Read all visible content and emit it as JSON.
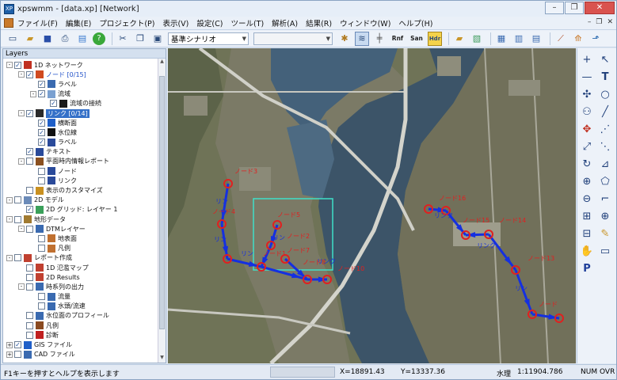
{
  "window": {
    "title": "xpswmm - [data.xp] [Network]",
    "app_icon": "XP",
    "controls": [
      "–",
      "❐",
      "✕"
    ]
  },
  "menubar": {
    "items": [
      "ファイル(F)",
      "編集(E)",
      "プロジェクト(P)",
      "表示(V)",
      "設定(C)",
      "ツール(T)",
      "解析(A)",
      "結果(R)",
      "ウィンドウ(W)",
      "ヘルプ(H)"
    ],
    "mdi_controls": [
      "–",
      "❐",
      "✕"
    ]
  },
  "toolbar": {
    "scenario": "基準シナリオ",
    "second_combo": "",
    "btn_rnf": "Rnf",
    "btn_san": "San",
    "btn_hdr": "Hdr"
  },
  "layers": {
    "title": "Layers",
    "tree": [
      {
        "label": "1D ネットワーク",
        "level": 0,
        "checked": true,
        "exp": "-"
      },
      {
        "label": "ノード",
        "count": "[0/15]",
        "level": 1,
        "checked": true,
        "exp": "-"
      },
      {
        "label": "ラベル",
        "level": 2,
        "checked": true
      },
      {
        "label": "流域",
        "level": 2,
        "checked": true,
        "exp": "-"
      },
      {
        "label": "流域の接続",
        "level": 3,
        "checked": true
      },
      {
        "label": "リンク",
        "count": "[0/14]",
        "level": 1,
        "checked": true,
        "exp": "-",
        "selected": true
      },
      {
        "label": "横断面",
        "level": 2,
        "checked": true
      },
      {
        "label": "水位線",
        "level": 2,
        "checked": true
      },
      {
        "label": "ラベル",
        "level": 2,
        "checked": true
      },
      {
        "label": "テキスト",
        "level": 1,
        "checked": true
      },
      {
        "label": "平面時内情報レポート",
        "level": 1,
        "checked": false,
        "exp": "-"
      },
      {
        "label": "ノード",
        "level": 2,
        "checked": false
      },
      {
        "label": "リンク",
        "level": 2,
        "checked": false
      },
      {
        "label": "表示のカスタマイズ",
        "level": 1,
        "checked": false
      },
      {
        "label": "2D モデル",
        "level": 0,
        "checked": false,
        "exp": "-"
      },
      {
        "label": "2D グリッド: レイヤー 1",
        "level": 1,
        "checked": true
      },
      {
        "label": "地形データ",
        "level": 0,
        "checked": false,
        "exp": "-"
      },
      {
        "label": "DTMレイヤー",
        "level": 1,
        "checked": false,
        "exp": "-"
      },
      {
        "label": "地表面",
        "level": 2,
        "checked": false
      },
      {
        "label": "凡例",
        "level": 2,
        "checked": false
      },
      {
        "label": "レポート作成",
        "level": 0,
        "checked": false,
        "exp": "-"
      },
      {
        "label": "1D 氾濫マップ",
        "level": 1,
        "checked": false
      },
      {
        "label": "2D Results",
        "level": 1,
        "checked": false
      },
      {
        "label": "時系列の出力",
        "level": 1,
        "checked": false,
        "exp": "-"
      },
      {
        "label": "流量",
        "level": 2,
        "checked": false
      },
      {
        "label": "水頭/流速",
        "level": 2,
        "checked": false
      },
      {
        "label": "水位面のプロフィール",
        "level": 1,
        "checked": false
      },
      {
        "label": "凡例",
        "level": 1,
        "checked": false
      },
      {
        "label": "診断",
        "level": 1,
        "checked": false
      },
      {
        "label": "GIS ファイル",
        "level": 0,
        "checked": true,
        "exp": "+"
      },
      {
        "label": "CAD ファイル",
        "level": 0,
        "checked": false,
        "exp": "+"
      }
    ]
  },
  "map": {
    "node_labels": [
      "ノード3",
      "ノード4",
      "ノード5",
      "ノード2",
      "ノード1",
      "ノード10",
      "ノード8",
      "ノード7",
      "ノード16",
      "ノード15",
      "ノード14",
      "ノード13",
      "ノード"
    ],
    "link_labels": [
      "リン",
      "リン",
      "リン",
      "リン",
      "リンク",
      "リンク",
      "リンク",
      "リン"
    ],
    "colors": {
      "node": "#e02020",
      "link": "#1530e0",
      "selection": "#3fe0c8",
      "water": "#3c5468"
    }
  },
  "statusbar": {
    "help": "F1キーを押すとヘルプを表示します",
    "x": "X=18891.43",
    "y": "Y=13337.36",
    "mode": "水理",
    "scale": "1:11904.786",
    "num": "NUM",
    "ovr": "OVR"
  }
}
